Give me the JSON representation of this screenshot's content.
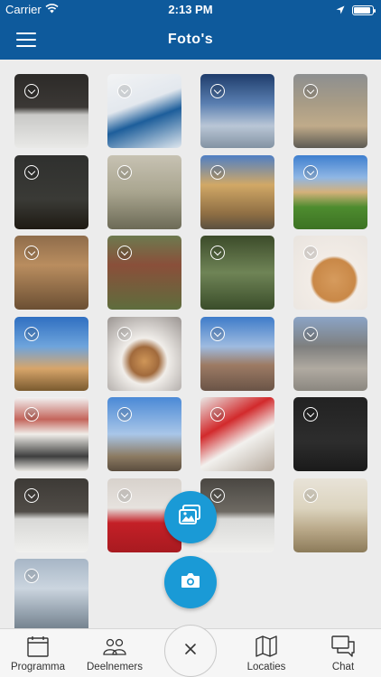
{
  "statusbar": {
    "carrier": "Carrier",
    "time": "2:13 PM",
    "battery_level": 0.9
  },
  "navbar": {
    "title": "Foto's",
    "menu_icon": "hamburger-icon"
  },
  "photos": [
    {
      "label": "keyboard photo",
      "bg": "linear-gradient(180deg,#2c2a28 0%,#3b3835 45%,#c9c9c7 55%,#e9e9e7 100%)"
    },
    {
      "label": "Onze vloot sign",
      "bg": "linear-gradient(160deg,#f2f3f4 0%,#e3e8ee 40%,#1d5e9b 60%,#dfe7ee 100%)"
    },
    {
      "label": "airplane window view",
      "bg": "linear-gradient(180deg,#1e3c6b 0%,#5a7fb1 40%,#b9c6d6 70%,#8393a3 100%)"
    },
    {
      "label": "building street",
      "bg": "linear-gradient(180deg,#8d8f90 0%,#a89c86 40%,#c0ab8a 70%,#5d5a53 100%)"
    },
    {
      "label": "night cityscape",
      "bg": "linear-gradient(180deg,#2f302e 0%,#3a3a36 60%,#1e1a13 100%)"
    },
    {
      "label": "greenhouse interior",
      "bg": "linear-gradient(180deg,#c7c2b3 0%,#a9a58f 50%,#6c6a56 100%)"
    },
    {
      "label": "yellow building with cars",
      "bg": "linear-gradient(180deg,#4f7fc4 0%,#d1a866 40%,#8d6d43 80%,#5a5040 100%)"
    },
    {
      "label": "lawn and building",
      "bg": "linear-gradient(180deg,#3e7fcf 0%,#8fb6e4 30%,#d4b17a 50%,#4e8c2f 70%,#3c7223 100%)"
    },
    {
      "label": "narrow street",
      "bg": "linear-gradient(180deg,#8f6c4b 0%,#b98d5f 40%,#6b4f33 100%)"
    },
    {
      "label": "garden courtyard",
      "bg": "linear-gradient(180deg,#6d7a4f 0%,#8a4f3a 40%,#5e6d3d 100%)"
    },
    {
      "label": "trees view",
      "bg": "linear-gradient(180deg,#3c4b2a 0%,#6f8456 50%,#3a4d2a 100%)"
    },
    {
      "label": "cookie",
      "bg": "radial-gradient(circle at 55% 60%,#d69b5d 0%,#c98847 35%,#f2ece6 40%,#e9e4df 100%)"
    },
    {
      "label": "palm tree",
      "bg": "linear-gradient(180deg,#2f6fc1 0%,#6ea4dc 40%,#d7a56a 70%,#7a5a2f 100%)"
    },
    {
      "label": "dessert plate",
      "bg": "radial-gradient(circle at 50% 60%,#cf9658 0%,#a16a3c 25%,#f1eeea 40%,#9a9491 100%)"
    },
    {
      "label": "city view",
      "bg": "linear-gradient(180deg,#3e7bc9 0%,#9ebbe0 40%,#9d7b64 65%,#6a5447 100%)"
    },
    {
      "label": "house front",
      "bg": "linear-gradient(180deg,#8ba4c6 0%,#7e7f7e 40%,#b0aaa1 70%,#8b8780 100%)"
    },
    {
      "label": "facade with balcony",
      "bg": "linear-gradient(180deg,#f2f2f2 0%,#c4655b 30%,#f0eee9 50%,#3e3e3e 80%,#e9e7e2 100%)"
    },
    {
      "label": "square with column",
      "bg": "linear-gradient(180deg,#4a89d6 0%,#a9c6e8 50%,#8c7a62 80%,#5a4d3e 100%)"
    },
    {
      "label": "red napkin and teapot",
      "bg": "linear-gradient(150deg,#e9e8e6 0%,#d22a2c 35%,#f2f1ee 60%,#b4a89c 100%)"
    },
    {
      "label": "dark fabric",
      "bg": "linear-gradient(180deg,#222 0%,#2d2d2d 60%,#1a1a1a 100%)"
    },
    {
      "label": "laptop keyboard",
      "bg": "linear-gradient(180deg,#3d3a36 0%,#504c47 45%,#d8d8d6 55%,#f0f0ee 100%)"
    },
    {
      "label": "coca-cola cup",
      "bg": "linear-gradient(180deg,#d8d2cc 0%,#e6e2de 40%,#c42027 60%,#a81a20 100%)"
    },
    {
      "label": "keyboard on desk",
      "bg": "linear-gradient(180deg,#4a4742 0%,#6e6a63 45%,#dadad8 55%,#f0f0ee 100%)"
    },
    {
      "label": "sugar packets",
      "bg": "linear-gradient(180deg,#e8e3d8 0%,#dcd4bf 40%,#b8a787 70%,#8c7b5a 100%)"
    },
    {
      "label": "water bottle",
      "bg": "linear-gradient(180deg,#a7b6c6 0%,#cbd5df 40%,#9aa7b3 70%,#6d7a86 100%)"
    }
  ],
  "fab_gallery": {
    "icon": "gallery-icon"
  },
  "fab_camera": {
    "icon": "camera-icon"
  },
  "tabbar": {
    "items": [
      {
        "label": "Programma",
        "icon": "calendar-icon"
      },
      {
        "label": "Deelnemers",
        "icon": "people-icon"
      },
      {
        "label": "Locaties",
        "icon": "map-icon"
      },
      {
        "label": "Chat",
        "icon": "chat-icon"
      }
    ],
    "close_icon": "close-icon"
  }
}
